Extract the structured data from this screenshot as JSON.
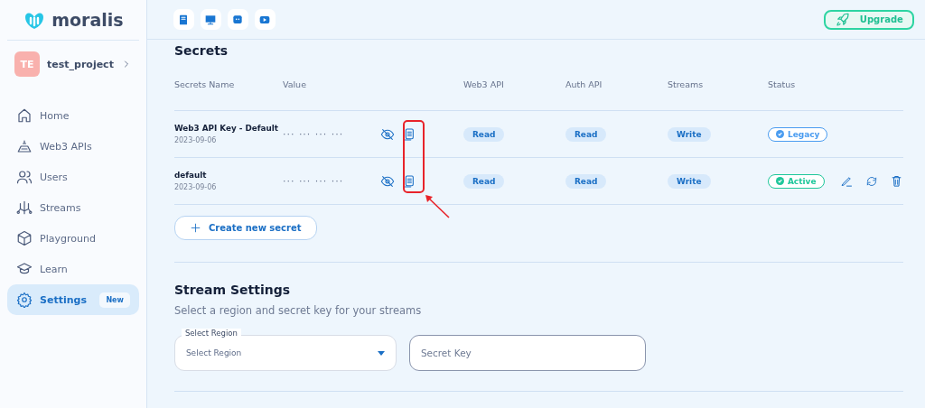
{
  "sidebar": {
    "logo": "moralis",
    "project": {
      "initials": "TE",
      "name": "test_project"
    },
    "items": [
      {
        "label": "Home",
        "selected": false
      },
      {
        "label": "Web3 APIs",
        "selected": false
      },
      {
        "label": "Users",
        "selected": false
      },
      {
        "label": "Streams",
        "selected": false
      },
      {
        "label": "Playground",
        "selected": false
      },
      {
        "label": "Learn",
        "selected": false
      },
      {
        "label": "Settings",
        "selected": true,
        "badge": "New"
      }
    ]
  },
  "toolbar": {
    "upgrade": "Upgrade"
  },
  "secrets": {
    "title": "Secrets",
    "columns": [
      "Secrets Name",
      "Value",
      "Web3 API",
      "Auth API",
      "Streams",
      "Status"
    ],
    "rows": [
      {
        "name": "Web3 API Key - Default",
        "date": "2023-09-06",
        "value": "··· ··· ··· ···",
        "web3": "Read",
        "auth": "Read",
        "streams": "Write",
        "status": "Legacy",
        "color": "#4a9cf0",
        "actions": false
      },
      {
        "name": "default",
        "date": "2023-09-06",
        "value": "··· ··· ··· ···",
        "web3": "Read",
        "auth": "Read",
        "streams": "Write",
        "status": "Active",
        "color": "#1fc79b",
        "actions": true
      }
    ],
    "create_button": "Create new secret"
  },
  "stream_settings": {
    "title": "Stream Settings",
    "subtitle": "Select a region and secret key for your streams",
    "region": {
      "label": "Select Region",
      "placeholder": "Select Region"
    },
    "secret_key": {
      "placeholder": "Secret Key"
    }
  }
}
